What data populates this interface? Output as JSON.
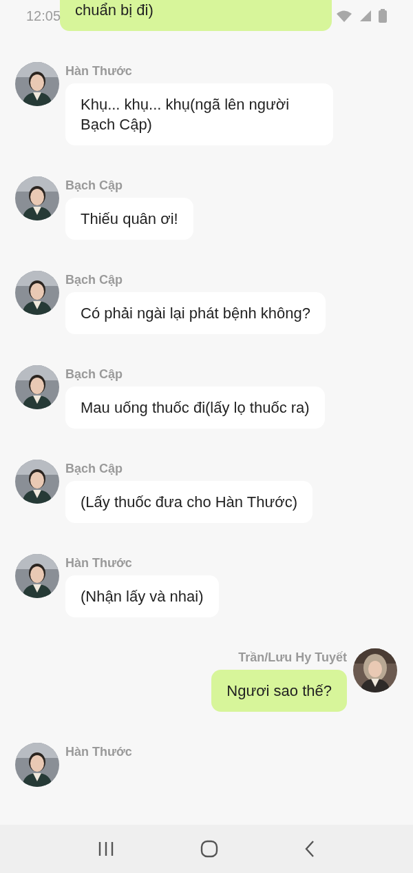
{
  "status_bar": {
    "time": "12:05"
  },
  "messages": [
    {
      "outgoing": true,
      "text": "chuẩn bị đi)",
      "cut_top": true
    },
    {
      "outgoing": false,
      "sender": "Hàn Thước",
      "text": "Khụ... khụ... khụ(ngã lên người Bạch Cập)"
    },
    {
      "outgoing": false,
      "sender": "Bạch Cập",
      "text": "Thiếu quân ơi!"
    },
    {
      "outgoing": false,
      "sender": "Bạch Cập",
      "text": "Có phải ngài lại phát bệnh không?"
    },
    {
      "outgoing": false,
      "sender": "Bạch Cập",
      "text": "Mau uống thuốc đi(lấy lọ thuốc ra)"
    },
    {
      "outgoing": false,
      "sender": "Bạch Cập",
      "text": "(Lấy thuốc đưa cho Hàn Thước)"
    },
    {
      "outgoing": false,
      "sender": "Hàn Thước",
      "text": "(Nhận lấy và nhai)"
    },
    {
      "outgoing": true,
      "sender": "Trần/Lưu Hy Tuyết",
      "text": "Ngươi sao thế?"
    },
    {
      "outgoing": false,
      "sender": "Hàn Thước"
    }
  ]
}
